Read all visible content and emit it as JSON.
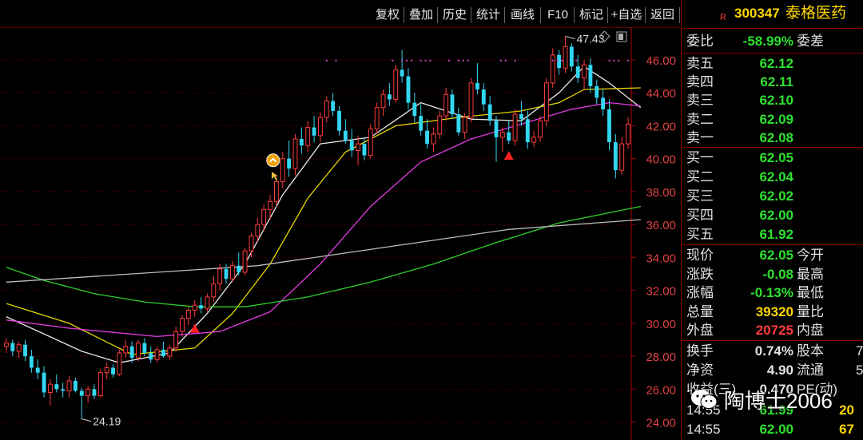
{
  "toolbar": {
    "buttons": [
      "复权",
      "叠加",
      "历史",
      "统计",
      "画线",
      "F10",
      "标记",
      "+自选",
      "返回"
    ]
  },
  "stock": {
    "marker": "R",
    "code": "300347",
    "name": "泰格医药"
  },
  "quote": {
    "weibi_label": "委比",
    "weibi_value": "-58.99%",
    "weicha_label": "委差",
    "sell": [
      {
        "label": "卖五",
        "price": "62.12"
      },
      {
        "label": "卖四",
        "price": "62.11"
      },
      {
        "label": "卖三",
        "price": "62.10"
      },
      {
        "label": "卖二",
        "price": "62.09"
      },
      {
        "label": "卖一",
        "price": "62.08"
      }
    ],
    "buy": [
      {
        "label": "买一",
        "price": "62.05"
      },
      {
        "label": "买二",
        "price": "62.04"
      },
      {
        "label": "买三",
        "price": "62.02"
      },
      {
        "label": "买四",
        "price": "62.00"
      },
      {
        "label": "买五",
        "price": "61.92"
      }
    ],
    "stats": [
      {
        "label": "现价",
        "value": "62.05",
        "label2": "今开"
      },
      {
        "label": "涨跌",
        "value": "-0.08",
        "label2": "最高"
      },
      {
        "label": "涨幅",
        "value": "-0.13%",
        "label2": "最低"
      },
      {
        "label": "总量",
        "value": "39320",
        "label2": "量比"
      },
      {
        "label": "外盘",
        "value": "20725",
        "label2": "内盘"
      }
    ],
    "stats2": [
      {
        "label": "换手",
        "value": "0.74%",
        "label2": "股本",
        "v2": "7"
      },
      {
        "label": "净资",
        "value": "4.90",
        "label2": "流通",
        "v2": "5"
      },
      {
        "label": "收益(三)",
        "value": "0.470",
        "label2": "PE(动)",
        "v2": ""
      }
    ],
    "ticks": [
      {
        "time": "14:55",
        "price": "61.99",
        "vol": "20"
      },
      {
        "time": "14:55",
        "price": "62.00",
        "vol": "67"
      }
    ]
  },
  "watermark": {
    "text": "陶博士2006"
  },
  "colors": {
    "up": "#ff3b3b",
    "down": "#33d6f0",
    "ma_white": "#e8e8e8",
    "ma_yellow": "#e6d800",
    "ma_magenta": "#e23ce2",
    "ma_green": "#2fd02f",
    "ma_gray": "#bdbdbd",
    "sell_value": "#2fe02f",
    "buy_value": "#2fe02f",
    "neg": "#2fe02f",
    "pos": "#ff3b3b",
    "code": "#ffd700"
  },
  "chart_data": {
    "type": "candlestick",
    "y_ticks": [
      "46.00",
      "44.00",
      "42.00",
      "40.00",
      "38.00",
      "36.00",
      "34.00",
      "32.00",
      "30.00",
      "28.00",
      "26.00",
      "24.00"
    ],
    "ylim": [
      23.3,
      47.6
    ],
    "annotations": [
      {
        "text": "47.43",
        "value": 47.43
      },
      {
        "text": "24.19",
        "value": 24.19
      }
    ],
    "candles": [
      [
        28.6,
        29.1,
        28.2,
        28.8
      ],
      [
        28.8,
        29.0,
        28.0,
        28.3
      ],
      [
        28.3,
        28.9,
        27.9,
        28.7
      ],
      [
        28.7,
        29.0,
        27.7,
        28.0
      ],
      [
        28.0,
        28.4,
        27.0,
        27.3
      ],
      [
        27.3,
        27.8,
        26.6,
        27.0
      ],
      [
        27.0,
        27.4,
        25.5,
        25.8
      ],
      [
        25.8,
        26.6,
        25.0,
        26.3
      ],
      [
        26.3,
        26.9,
        25.8,
        26.0
      ],
      [
        26.0,
        26.4,
        25.5,
        25.9
      ],
      [
        25.9,
        26.8,
        25.5,
        26.5
      ],
      [
        26.5,
        26.7,
        25.8,
        25.9
      ],
      [
        25.9,
        26.1,
        24.19,
        25.6
      ],
      [
        25.6,
        26.2,
        25.2,
        26.0
      ],
      [
        26.0,
        26.3,
        25.4,
        25.6
      ],
      [
        25.6,
        27.2,
        25.5,
        27.0
      ],
      [
        27.0,
        27.6,
        26.6,
        27.3
      ],
      [
        27.3,
        27.5,
        26.7,
        26.9
      ],
      [
        26.9,
        28.4,
        26.8,
        28.2
      ],
      [
        28.2,
        29.0,
        27.9,
        28.6
      ],
      [
        28.6,
        28.9,
        27.6,
        27.9
      ],
      [
        27.9,
        29.0,
        27.7,
        28.8
      ],
      [
        28.8,
        29.1,
        28.0,
        28.2
      ],
      [
        28.2,
        28.6,
        27.6,
        27.8
      ],
      [
        27.8,
        28.6,
        27.6,
        28.4
      ],
      [
        28.4,
        28.9,
        27.9,
        28.0
      ],
      [
        28.0,
        28.7,
        27.8,
        28.5
      ],
      [
        28.5,
        29.8,
        28.3,
        29.5
      ],
      [
        29.5,
        30.5,
        29.2,
        30.3
      ],
      [
        30.3,
        31.0,
        29.9,
        30.8
      ],
      [
        30.8,
        31.4,
        30.4,
        31.1
      ],
      [
        31.1,
        31.6,
        30.6,
        30.9
      ],
      [
        30.9,
        31.8,
        30.7,
        31.6
      ],
      [
        31.6,
        32.9,
        31.3,
        32.4
      ],
      [
        32.4,
        33.6,
        32.0,
        33.3
      ],
      [
        33.3,
        33.6,
        32.4,
        32.7
      ],
      [
        32.7,
        33.8,
        32.5,
        33.5
      ],
      [
        33.5,
        34.3,
        32.9,
        33.1
      ],
      [
        33.1,
        34.6,
        32.9,
        34.4
      ],
      [
        34.4,
        35.5,
        34.0,
        35.3
      ],
      [
        35.3,
        36.4,
        34.9,
        36.0
      ],
      [
        36.0,
        37.2,
        35.6,
        36.9
      ],
      [
        36.9,
        37.8,
        36.3,
        37.4
      ],
      [
        37.4,
        38.9,
        37.1,
        38.6
      ],
      [
        38.6,
        40.4,
        38.2,
        40.0
      ],
      [
        40.0,
        41.1,
        38.9,
        39.4
      ],
      [
        39.4,
        41.5,
        39.0,
        41.2
      ],
      [
        41.2,
        41.9,
        40.3,
        40.8
      ],
      [
        40.8,
        42.3,
        40.4,
        41.9
      ],
      [
        41.9,
        42.6,
        41.0,
        41.4
      ],
      [
        41.4,
        42.8,
        41.0,
        42.5
      ],
      [
        42.5,
        43.8,
        42.2,
        43.5
      ],
      [
        43.5,
        44.0,
        42.6,
        42.9
      ],
      [
        42.9,
        43.2,
        41.4,
        41.7
      ],
      [
        41.7,
        42.4,
        40.9,
        41.1
      ],
      [
        41.1,
        41.8,
        40.1,
        40.5
      ],
      [
        40.5,
        41.4,
        39.6,
        40.9
      ],
      [
        40.9,
        41.2,
        39.9,
        40.2
      ],
      [
        40.2,
        42.1,
        40.0,
        41.8
      ],
      [
        41.8,
        43.4,
        41.5,
        43.1
      ],
      [
        43.1,
        44.2,
        42.6,
        43.9
      ],
      [
        43.9,
        44.6,
        43.2,
        43.6
      ],
      [
        43.6,
        45.7,
        43.4,
        45.4
      ],
      [
        45.4,
        46.6,
        44.6,
        45.0
      ],
      [
        45.0,
        45.5,
        43.0,
        43.4
      ],
      [
        43.4,
        44.0,
        42.2,
        42.6
      ],
      [
        42.6,
        43.3,
        41.4,
        41.7
      ],
      [
        41.7,
        42.4,
        40.6,
        40.9
      ],
      [
        40.9,
        41.9,
        40.4,
        41.5
      ],
      [
        41.5,
        42.9,
        41.2,
        42.6
      ],
      [
        42.6,
        44.3,
        42.3,
        43.9
      ],
      [
        43.9,
        44.2,
        42.4,
        42.7
      ],
      [
        42.7,
        43.1,
        41.4,
        41.6
      ],
      [
        41.6,
        42.8,
        41.2,
        42.5
      ],
      [
        42.5,
        44.9,
        42.2,
        44.6
      ],
      [
        44.6,
        45.8,
        43.9,
        44.2
      ],
      [
        44.2,
        44.6,
        42.9,
        43.3
      ],
      [
        43.3,
        43.8,
        42.0,
        42.3
      ],
      [
        42.3,
        42.6,
        39.8,
        41.3
      ],
      [
        41.3,
        41.9,
        40.4,
        41.6
      ],
      [
        41.6,
        42.3,
        40.9,
        41.1
      ],
      [
        41.1,
        43.0,
        40.8,
        42.7
      ],
      [
        42.7,
        43.5,
        42.0,
        42.4
      ],
      [
        42.4,
        42.9,
        40.6,
        41.0
      ],
      [
        41.0,
        41.7,
        40.7,
        41.3
      ],
      [
        41.3,
        42.6,
        41.0,
        42.3
      ],
      [
        42.3,
        44.9,
        42.0,
        44.6
      ],
      [
        44.6,
        46.7,
        44.3,
        46.3
      ],
      [
        46.3,
        46.6,
        45.1,
        45.5
      ],
      [
        45.5,
        47.43,
        45.2,
        46.8
      ],
      [
        46.8,
        47.0,
        45.3,
        45.6
      ],
      [
        45.6,
        46.3,
        44.6,
        44.9
      ],
      [
        44.9,
        46.0,
        44.2,
        45.7
      ],
      [
        45.7,
        46.1,
        44.0,
        44.4
      ],
      [
        44.4,
        44.8,
        43.3,
        43.7
      ],
      [
        43.7,
        44.2,
        42.6,
        43.0
      ],
      [
        43.0,
        43.6,
        40.5,
        41.0
      ],
      [
        41.0,
        41.5,
        38.8,
        39.3
      ],
      [
        39.3,
        41.3,
        39.0,
        40.9
      ],
      [
        40.9,
        42.5,
        40.6,
        42.1
      ]
    ],
    "moving_averages": [
      {
        "color_key": "ma_white",
        "points": [
          [
            0,
            30.4
          ],
          [
            12,
            28.3
          ],
          [
            18,
            27.6
          ],
          [
            26,
            28.2
          ],
          [
            32,
            30.6
          ],
          [
            38,
            33.6
          ],
          [
            44,
            37.8
          ],
          [
            50,
            40.9
          ],
          [
            58,
            41.3
          ],
          [
            66,
            43.4
          ],
          [
            74,
            42.4
          ],
          [
            82,
            42.3
          ],
          [
            88,
            44.0
          ],
          [
            92,
            45.6
          ],
          [
            96,
            44.6
          ],
          [
            101,
            43.1
          ]
        ]
      },
      {
        "color_key": "ma_yellow",
        "points": [
          [
            0,
            31.2
          ],
          [
            10,
            30.0
          ],
          [
            20,
            28.1
          ],
          [
            30,
            28.5
          ],
          [
            36,
            30.6
          ],
          [
            42,
            33.6
          ],
          [
            48,
            37.6
          ],
          [
            54,
            40.4
          ],
          [
            62,
            42.0
          ],
          [
            72,
            42.5
          ],
          [
            82,
            42.9
          ],
          [
            88,
            43.4
          ],
          [
            92,
            44.2
          ],
          [
            101,
            44.3
          ]
        ]
      },
      {
        "color_key": "ma_magenta",
        "points": [
          [
            0,
            30.2
          ],
          [
            10,
            29.7
          ],
          [
            24,
            29.2
          ],
          [
            34,
            29.5
          ],
          [
            42,
            30.7
          ],
          [
            50,
            33.6
          ],
          [
            58,
            37.1
          ],
          [
            66,
            39.8
          ],
          [
            74,
            41.2
          ],
          [
            82,
            42.1
          ],
          [
            90,
            43.0
          ],
          [
            96,
            43.4
          ],
          [
            101,
            43.2
          ]
        ]
      },
      {
        "color_key": "ma_green",
        "points": [
          [
            0,
            33.4
          ],
          [
            6,
            32.6
          ],
          [
            14,
            31.8
          ],
          [
            22,
            31.3
          ],
          [
            30,
            31.0
          ],
          [
            38,
            31.0
          ],
          [
            48,
            31.6
          ],
          [
            58,
            32.5
          ],
          [
            68,
            33.6
          ],
          [
            78,
            34.9
          ],
          [
            88,
            36.1
          ],
          [
            101,
            37.1
          ]
        ]
      },
      {
        "color_key": "ma_gray",
        "points": [
          [
            0,
            32.5
          ],
          [
            20,
            33.0
          ],
          [
            40,
            33.5
          ],
          [
            60,
            34.6
          ],
          [
            80,
            35.7
          ],
          [
            101,
            36.3
          ]
        ]
      }
    ],
    "buy_markers": [
      30,
      80
    ],
    "dots_y_fraction": 0.05
  }
}
